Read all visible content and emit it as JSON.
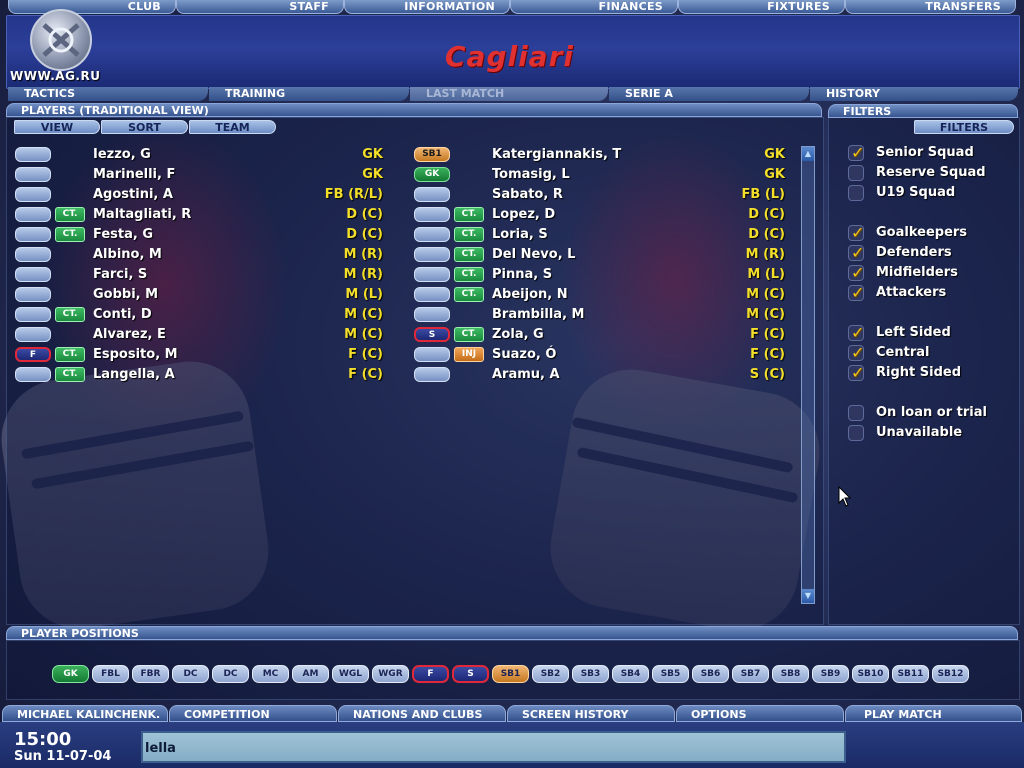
{
  "top_tabs": [
    {
      "label": "CLUB"
    },
    {
      "label": "STAFF"
    },
    {
      "label": "INFORMATION"
    },
    {
      "label": "FINANCES"
    },
    {
      "label": "FIXTURES"
    },
    {
      "label": "TRANSFERS"
    }
  ],
  "header": {
    "team_name": "Cagliari",
    "watermark": "WWW.AG.RU"
  },
  "sub_tabs": [
    {
      "label": "TACTICS"
    },
    {
      "label": "TRAINING"
    },
    {
      "label": "LAST MATCH"
    },
    {
      "label": "SERIE A"
    },
    {
      "label": "HISTORY"
    }
  ],
  "players_panel": {
    "title": "PLAYERS (TRADITIONAL VIEW)",
    "controls": {
      "view": "VIEW",
      "sort": "SORT",
      "team": "TEAM"
    }
  },
  "players_left": [
    {
      "name": "Iezzo, G",
      "position": "GK"
    },
    {
      "name": "Marinelli, F",
      "position": "GK"
    },
    {
      "name": "Agostini, A",
      "position": "FB (R/L)"
    },
    {
      "name": "Maltagliati, R",
      "position": "D (C)",
      "badge": "CT."
    },
    {
      "name": "Festa, G",
      "position": "D (C)",
      "badge": "CT."
    },
    {
      "name": "Albino, M",
      "position": "M (R)"
    },
    {
      "name": "Farci, S",
      "position": "M (R)"
    },
    {
      "name": "Gobbi, M",
      "position": "M (L)"
    },
    {
      "name": "Conti, D",
      "position": "M (C)",
      "badge": "CT."
    },
    {
      "name": "Alvarez, E",
      "position": "M (C)"
    },
    {
      "name": "Esposito, M",
      "position": "F (C)",
      "badge": "CT.",
      "button": "F"
    },
    {
      "name": "Langella, A",
      "position": "F (C)",
      "badge": "CT."
    }
  ],
  "players_right": [
    {
      "name": "Katergiannakis, T",
      "position": "GK",
      "button": "SB1"
    },
    {
      "name": "Tomasig, L",
      "position": "GK",
      "button": "GK"
    },
    {
      "name": "Sabato, R",
      "position": "FB (L)"
    },
    {
      "name": "Lopez, D",
      "position": "D (C)",
      "badge": "CT."
    },
    {
      "name": "Loria, S",
      "position": "D (C)",
      "badge": "CT."
    },
    {
      "name": "Del Nevo, L",
      "position": "M (R)",
      "badge": "CT."
    },
    {
      "name": "Pinna, S",
      "position": "M (L)",
      "badge": "CT."
    },
    {
      "name": "Abeijon, N",
      "position": "M (C)",
      "badge": "CT."
    },
    {
      "name": "Brambilla, M",
      "position": "M (C)"
    },
    {
      "name": "Zola, G",
      "position": "F (C)",
      "badge": "CT.",
      "button": "S"
    },
    {
      "name": "Suazo, Ó",
      "position": "F (C)",
      "badge": "INJ"
    },
    {
      "name": "Aramu, A",
      "position": "S (C)"
    }
  ],
  "filters_panel": {
    "title": "FILTERS",
    "button": "FILTERS",
    "items": [
      {
        "label": "Senior Squad",
        "checked": true
      },
      {
        "label": "Reserve Squad",
        "checked": false
      },
      {
        "label": "U19 Squad",
        "checked": false
      },
      {
        "label": "Goalkeepers",
        "checked": true
      },
      {
        "label": "Defenders",
        "checked": true
      },
      {
        "label": "Midfielders",
        "checked": true
      },
      {
        "label": "Attackers",
        "checked": true
      },
      {
        "label": "Left Sided",
        "checked": true
      },
      {
        "label": "Central",
        "checked": true
      },
      {
        "label": "Right Sided",
        "checked": true
      },
      {
        "label": "On loan or trial",
        "checked": false
      },
      {
        "label": "Unavailable",
        "checked": false
      }
    ]
  },
  "positions_panel": {
    "title": "PLAYER POSITIONS",
    "slots": [
      "GK",
      "FBL",
      "FBR",
      "DC",
      "DC",
      "MC",
      "AM",
      "WGL",
      "WGR",
      "F",
      "S",
      "SB1",
      "SB2",
      "SB3",
      "SB4",
      "SB5",
      "SB6",
      "SB7",
      "SB8",
      "SB9",
      "SB10",
      "SB11",
      "SB12"
    ]
  },
  "bottom_tabs": [
    {
      "label": "MICHAEL KALINCHENK."
    },
    {
      "label": "COMPETITION"
    },
    {
      "label": "NATIONS AND CLUBS"
    },
    {
      "label": "SCREEN HISTORY"
    },
    {
      "label": "OPTIONS"
    },
    {
      "label": "PLAY MATCH"
    }
  ],
  "status": {
    "time": "15:00",
    "date": "Sun 11-07-04",
    "search_value": "lella"
  }
}
